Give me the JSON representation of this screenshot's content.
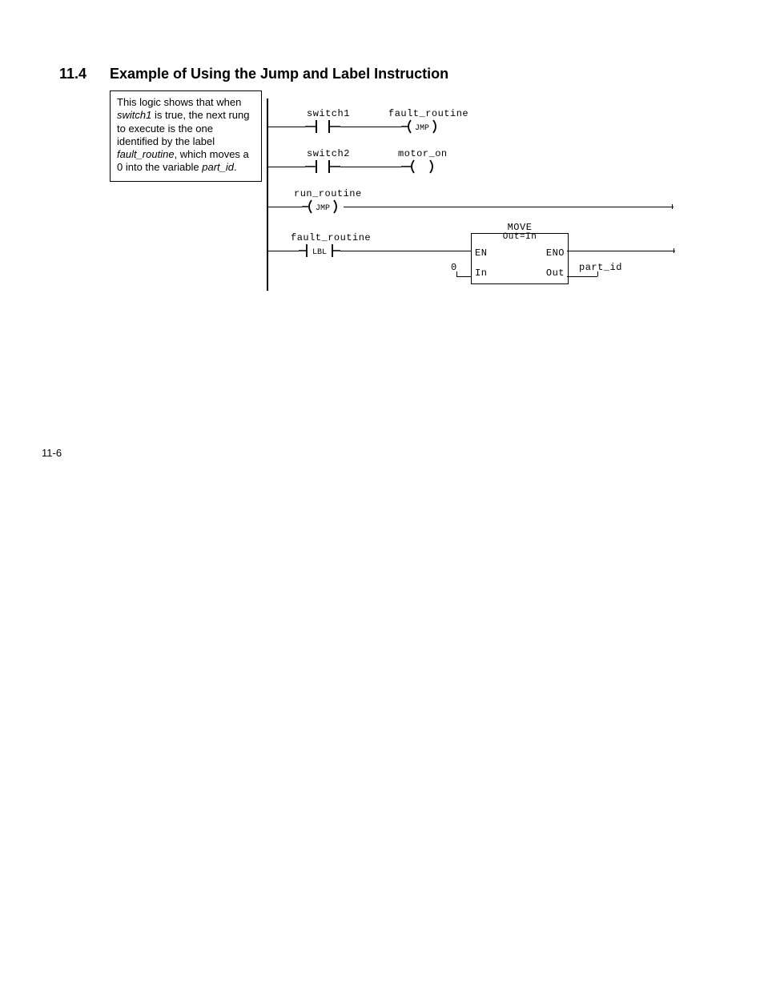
{
  "heading": {
    "number": "11.4",
    "title": "Example of Using the Jump and Label Instruction"
  },
  "description": {
    "text_pre": "This logic shows that when ",
    "switch1": "switch1",
    "text_mid1": " is true, the next rung to execute is the one identified by the label ",
    "fault_routine": "fault_routine",
    "text_mid2": ", which moves a 0 into the variable ",
    "part_id": "part_id",
    "text_end": "."
  },
  "ladder": {
    "rung1": {
      "contact_label": "switch1",
      "coil_label": "fault_routine",
      "coil_type": "JMP"
    },
    "rung2": {
      "contact_label": "switch2",
      "coil_label": "motor_on"
    },
    "rung3": {
      "coil_label": "run_routine",
      "coil_type": "JMP"
    },
    "rung4": {
      "lbl_label": "fault_routine",
      "lbl_type": "LBL",
      "block": {
        "title": "MOVE",
        "subtitle": "Out=In",
        "en": "EN",
        "eno": "ENO",
        "in_label": "In",
        "in_value": "0",
        "out_label": "Out",
        "out_tag": "part_id"
      }
    }
  },
  "footer": {
    "page": "11-6"
  }
}
